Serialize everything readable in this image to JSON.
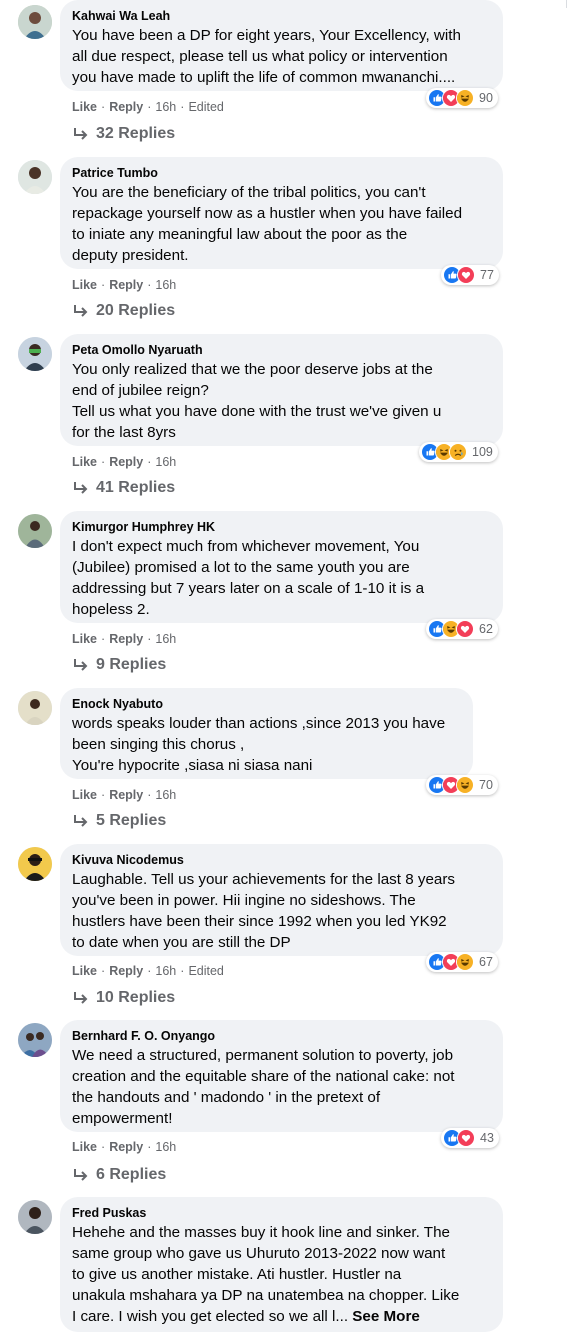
{
  "comments": [
    {
      "author": "Kahwai Wa Leah",
      "text_lines": [
        "You have been a DP for eight years, Your Excellency, with",
        "all due respect, please tell us what policy or intervention",
        "you have made to uplift the life of common mwananchi...."
      ],
      "like_label": "Like",
      "reply_label": "Reply",
      "time": "16h",
      "edited": "Edited",
      "reactions": [
        "like",
        "love",
        "haha"
      ],
      "reaction_count": "90",
      "replies_label": "32 Replies"
    },
    {
      "author": "Patrice Tumbo",
      "text_lines": [
        "You are the beneficiary of the tribal politics, you can't",
        "repackage yourself now as a hustler when you have failed",
        "to iniate any meaningful law about the poor as the",
        "deputy president."
      ],
      "like_label": "Like",
      "reply_label": "Reply",
      "time": "16h",
      "edited": "",
      "reactions": [
        "like",
        "love"
      ],
      "reaction_count": "77",
      "replies_label": "20 Replies"
    },
    {
      "author": "Peta Omollo Nyaruath",
      "text_lines": [
        "You only realized that we the poor deserve jobs at the",
        "end of jubilee reign?",
        "Tell us what you have done with the trust we've given u",
        "for the last 8yrs"
      ],
      "like_label": "Like",
      "reply_label": "Reply",
      "time": "16h",
      "edited": "",
      "reactions": [
        "like",
        "haha",
        "sad"
      ],
      "reaction_count": "109",
      "replies_label": "41 Replies"
    },
    {
      "author": "Kimurgor Humphrey HK",
      "text_lines": [
        "I don't expect much from whichever movement, You",
        "(Jubilee) promised a lot to the same youth you are",
        "addressing but 7 years later on a scale of 1-10 it is a",
        "hopeless 2."
      ],
      "like_label": "Like",
      "reply_label": "Reply",
      "time": "16h",
      "edited": "",
      "reactions": [
        "like",
        "haha",
        "love"
      ],
      "reaction_count": "62",
      "replies_label": "9 Replies"
    },
    {
      "author": "Enock Nyabuto",
      "text_lines": [
        "words speaks louder than actions ,since 2013 you have",
        "been singing this chorus ,",
        "You're hypocrite ,siasa ni siasa nani"
      ],
      "like_label": "Like",
      "reply_label": "Reply",
      "time": "16h",
      "edited": "",
      "reactions": [
        "like",
        "love",
        "haha"
      ],
      "reaction_count": "70",
      "replies_label": "5 Replies"
    },
    {
      "author": "Kivuva Nicodemus",
      "text_lines": [
        "Laughable. Tell us your achievements for the last 8 years",
        "you've been in power. Hii ingine no sideshows. The",
        "hustlers have been their since 1992 when you led YK92",
        "to date when you are still the DP"
      ],
      "like_label": "Like",
      "reply_label": "Reply",
      "time": "16h",
      "edited": "Edited",
      "reactions": [
        "like",
        "love",
        "haha"
      ],
      "reaction_count": "67",
      "replies_label": "10 Replies"
    },
    {
      "author": "Bernhard F. O. Onyango",
      "text_lines": [
        "We need a structured, permanent solution to poverty, job",
        "creation and the equitable share of the national cake: not",
        "the handouts and ' madondo ' in the pretext of",
        "empowerment!"
      ],
      "like_label": "Like",
      "reply_label": "Reply",
      "time": "16h",
      "edited": "",
      "reactions": [
        "like",
        "love"
      ],
      "reaction_count": "43",
      "replies_label": "6 Replies"
    },
    {
      "author": "Fred Puskas",
      "text_lines": [
        "Hehehe and the masses buy it hook line and sinker. The",
        "same group who gave us Uhuruto 2013-2022 now want",
        "to give us another mistake. Ati hustler. Hustler na",
        "unakula mshahara ya DP na unatembea na chopper. Like",
        "I care. I wish you get elected so we all l..."
      ],
      "see_more": "See More"
    }
  ],
  "colors": {
    "like": "#1877f2",
    "love": "#f33e58",
    "haha": "#f7b125",
    "bubble": "#f0f2f5",
    "meta": "#65676b"
  }
}
